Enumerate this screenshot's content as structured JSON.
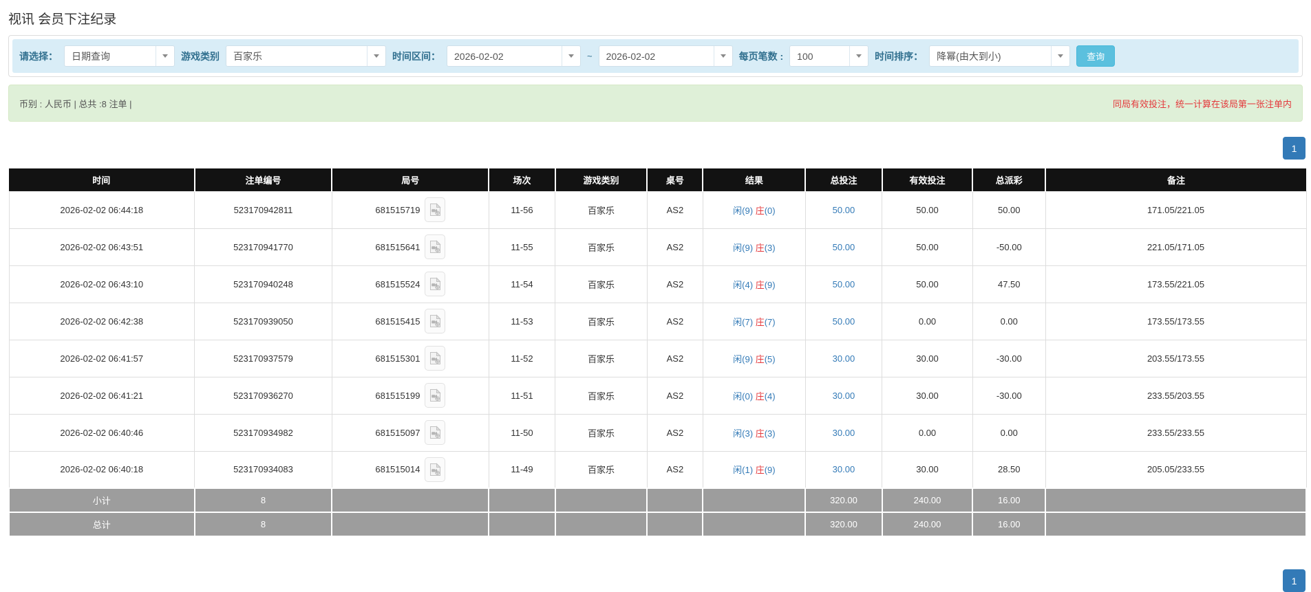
{
  "page": {
    "title": "视讯 会员下注纪录"
  },
  "colors": {
    "filter_bg": "#d9edf7",
    "filter_label": "#31708f",
    "button_bg": "#5bc0de",
    "success_bg": "#dff0d8",
    "banner_red": "#e4393c",
    "link_blue": "#337ab7",
    "negative_red": "#ff0000",
    "header_bg": "#121212",
    "summary_row_bg": "#9d9d9d",
    "pagination_blue": "#337ab7"
  },
  "filters": {
    "select_label": "请选择：",
    "select_value": "日期查询",
    "game_type_label": "游戏类别",
    "game_type_value": "百家乐",
    "time_range_label": "时间区间：",
    "date_from": "2026-02-02",
    "range_separator": "~",
    "date_to": "2026-02-02",
    "page_size_label": "每页笔数 :",
    "page_size_value": "100",
    "sort_label": "时间排序：",
    "sort_value": "降幂(由大到小)",
    "search_button": "查询"
  },
  "summary_bar": {
    "left": "币别 : 人民币 | 总共 :8 注单 |",
    "right": "同局有效投注，统一计算在该局第一张注单内"
  },
  "pagination": {
    "page": "1"
  },
  "table": {
    "columns": [
      "时间",
      "注单编号",
      "局号",
      "场次",
      "游戏类别",
      "桌号",
      "结果",
      "总投注",
      "有效投注",
      "总派彩",
      "备注"
    ],
    "result_labels": {
      "player": "闲",
      "banker": "庄"
    },
    "rows": [
      {
        "time": "2026-02-02 06:44:18",
        "bet_id": "523170942811",
        "round_id": "681515719",
        "session": "11-56",
        "game": "百家乐",
        "table_no": "AS2",
        "player": 9,
        "banker": 0,
        "total_bet": "50.00",
        "valid_bet": "50.00",
        "payout": "50.00",
        "payout_negative": false,
        "remark": "171.05/221.05"
      },
      {
        "time": "2026-02-02 06:43:51",
        "bet_id": "523170941770",
        "round_id": "681515641",
        "session": "11-55",
        "game": "百家乐",
        "table_no": "AS2",
        "player": 9,
        "banker": 3,
        "total_bet": "50.00",
        "valid_bet": "50.00",
        "payout": "-50.00",
        "payout_negative": true,
        "remark": "221.05/171.05"
      },
      {
        "time": "2026-02-02 06:43:10",
        "bet_id": "523170940248",
        "round_id": "681515524",
        "session": "11-54",
        "game": "百家乐",
        "table_no": "AS2",
        "player": 4,
        "banker": 9,
        "total_bet": "50.00",
        "valid_bet": "50.00",
        "payout": "47.50",
        "payout_negative": false,
        "remark": "173.55/221.05"
      },
      {
        "time": "2026-02-02 06:42:38",
        "bet_id": "523170939050",
        "round_id": "681515415",
        "session": "11-53",
        "game": "百家乐",
        "table_no": "AS2",
        "player": 7,
        "banker": 7,
        "total_bet": "50.00",
        "valid_bet": "0.00",
        "payout": "0.00",
        "payout_negative": false,
        "remark": "173.55/173.55"
      },
      {
        "time": "2026-02-02 06:41:57",
        "bet_id": "523170937579",
        "round_id": "681515301",
        "session": "11-52",
        "game": "百家乐",
        "table_no": "AS2",
        "player": 9,
        "banker": 5,
        "total_bet": "30.00",
        "valid_bet": "30.00",
        "payout": "-30.00",
        "payout_negative": true,
        "remark": "203.55/173.55"
      },
      {
        "time": "2026-02-02 06:41:21",
        "bet_id": "523170936270",
        "round_id": "681515199",
        "session": "11-51",
        "game": "百家乐",
        "table_no": "AS2",
        "player": 0,
        "banker": 4,
        "total_bet": "30.00",
        "valid_bet": "30.00",
        "payout": "-30.00",
        "payout_negative": true,
        "remark": "233.55/203.55"
      },
      {
        "time": "2026-02-02 06:40:46",
        "bet_id": "523170934982",
        "round_id": "681515097",
        "session": "11-50",
        "game": "百家乐",
        "table_no": "AS2",
        "player": 3,
        "banker": 3,
        "total_bet": "30.00",
        "valid_bet": "0.00",
        "payout": "0.00",
        "payout_negative": false,
        "remark": "233.55/233.55"
      },
      {
        "time": "2026-02-02 06:40:18",
        "bet_id": "523170934083",
        "round_id": "681515014",
        "session": "11-49",
        "game": "百家乐",
        "table_no": "AS2",
        "player": 1,
        "banker": 9,
        "total_bet": "30.00",
        "valid_bet": "30.00",
        "payout": "28.50",
        "payout_negative": false,
        "remark": "205.05/233.55"
      }
    ],
    "subtotal": {
      "label": "小计",
      "count": "8",
      "total_bet": "320.00",
      "valid_bet": "240.00",
      "payout": "16.00"
    },
    "total": {
      "label": "总计",
      "count": "8",
      "total_bet": "320.00",
      "valid_bet": "240.00",
      "payout": "16.00"
    }
  }
}
